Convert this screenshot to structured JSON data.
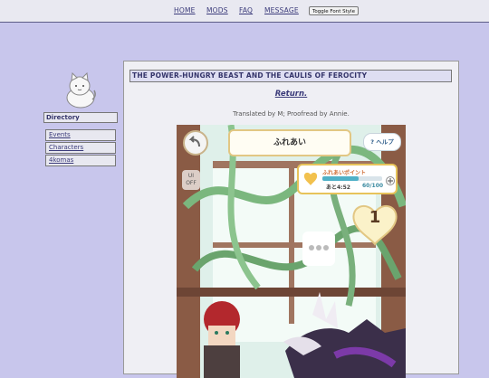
{
  "nav": {
    "home": "HOME",
    "mods": "MODS",
    "faq": "FAQ",
    "message": "MESSAGE",
    "toggle": "Toggle Font Style"
  },
  "sidebar": {
    "title": "Directory",
    "items": [
      {
        "label": "Events"
      },
      {
        "label": "Characters"
      },
      {
        "label": "4komas"
      }
    ]
  },
  "main": {
    "title": "THE POWER-HUNGRY BEAST AND THE CAULIS OF FEROCITY",
    "return_link": "Return.",
    "credits": "Translated by M; Proofread by Annie."
  },
  "game": {
    "screen_title": "ふれあい",
    "help": "? ヘルプ",
    "ui_off_top": "UI",
    "ui_off_bottom": "OFF",
    "points_label": "ふれあいポイント",
    "points_time": "あと4:52",
    "points_value": "60/100",
    "heart_number": "1",
    "colors": {
      "pillar": "#8a5b45",
      "vine": "#7bb77e",
      "gold": "#e7c35a"
    }
  }
}
